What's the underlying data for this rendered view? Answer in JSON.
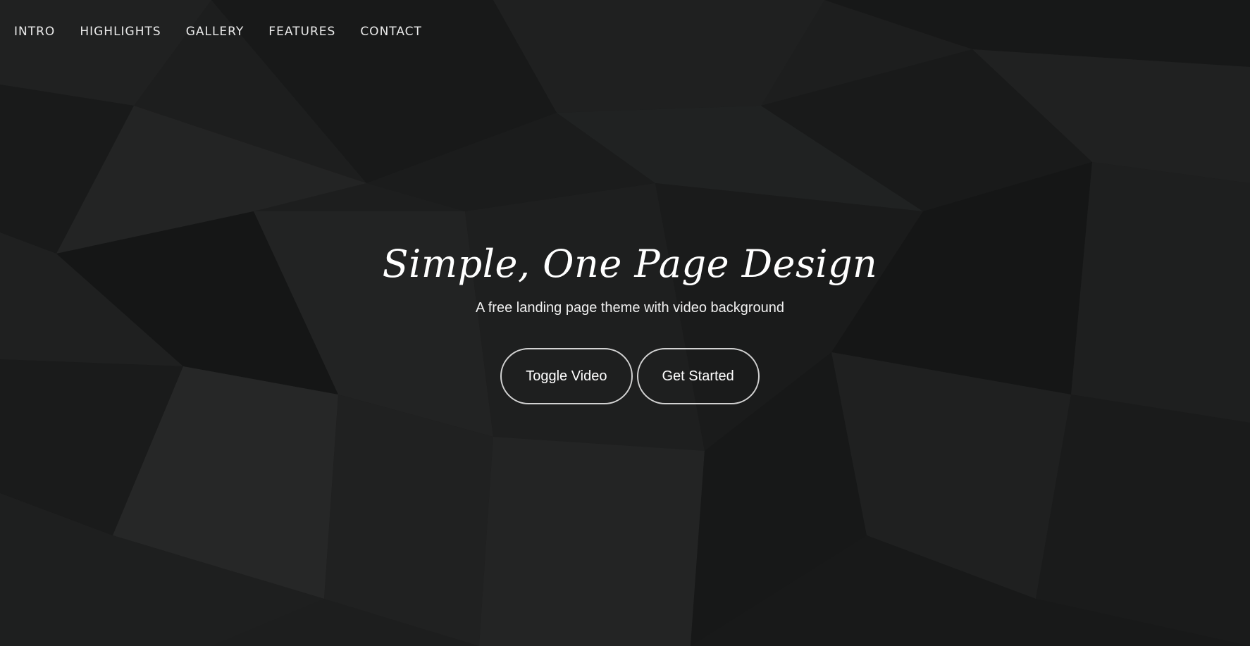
{
  "nav": {
    "items": [
      "INTRO",
      "HIGHLIGHTS",
      "GALLERY",
      "FEATURES",
      "CONTACT"
    ]
  },
  "hero": {
    "title": "Simple, One Page Design",
    "subtitle": "A free landing page theme with video background",
    "buttons": {
      "toggle_video": "Toggle Video",
      "get_started": "Get Started"
    }
  },
  "colors": {
    "background": "#1d1e1e",
    "text": "#ffffff",
    "button_border": "#d9d9d9"
  }
}
